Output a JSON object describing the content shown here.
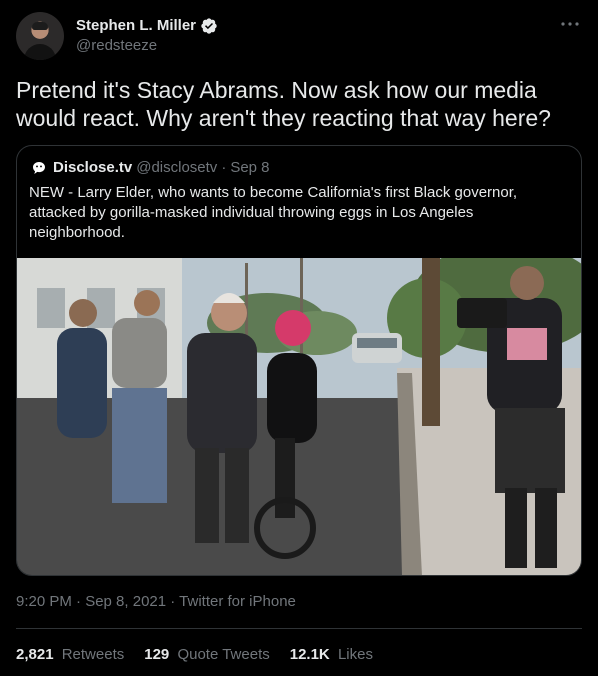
{
  "author": {
    "name": "Stephen L. Miller",
    "handle": "@redsteeze"
  },
  "tweet": {
    "text": "Pretend it's Stacy Abrams. Now ask how our media\nwould react. Why aren't they reacting that way here?"
  },
  "quote": {
    "name": "Disclose.tv",
    "handle": "@disclosetv",
    "separator": "·",
    "date": "Sep 8",
    "text": "NEW - Larry Elder, who wants to become California's first Black governor,\nattacked by gorilla-masked individual throwing eggs in Los Angeles\nneighborhood."
  },
  "meta": {
    "timestamp": "9:20 PM · Sep 8, 2021 · Twitter for iPhone"
  },
  "stats": [
    {
      "count": "2,821",
      "label": "Retweets"
    },
    {
      "count": "129",
      "label": "Quote Tweets"
    },
    {
      "count": "12.1K",
      "label": "Likes"
    }
  ],
  "colors": {
    "background": "#000000",
    "text_primary": "#e7e9ea",
    "text_secondary": "#71767b",
    "border": "#2f3336",
    "verified": "#e7e9ea"
  },
  "icons": {
    "verified": "verified-badge-icon",
    "more": "more-dots-icon",
    "quote_avatar": "disclose-logo-icon"
  }
}
